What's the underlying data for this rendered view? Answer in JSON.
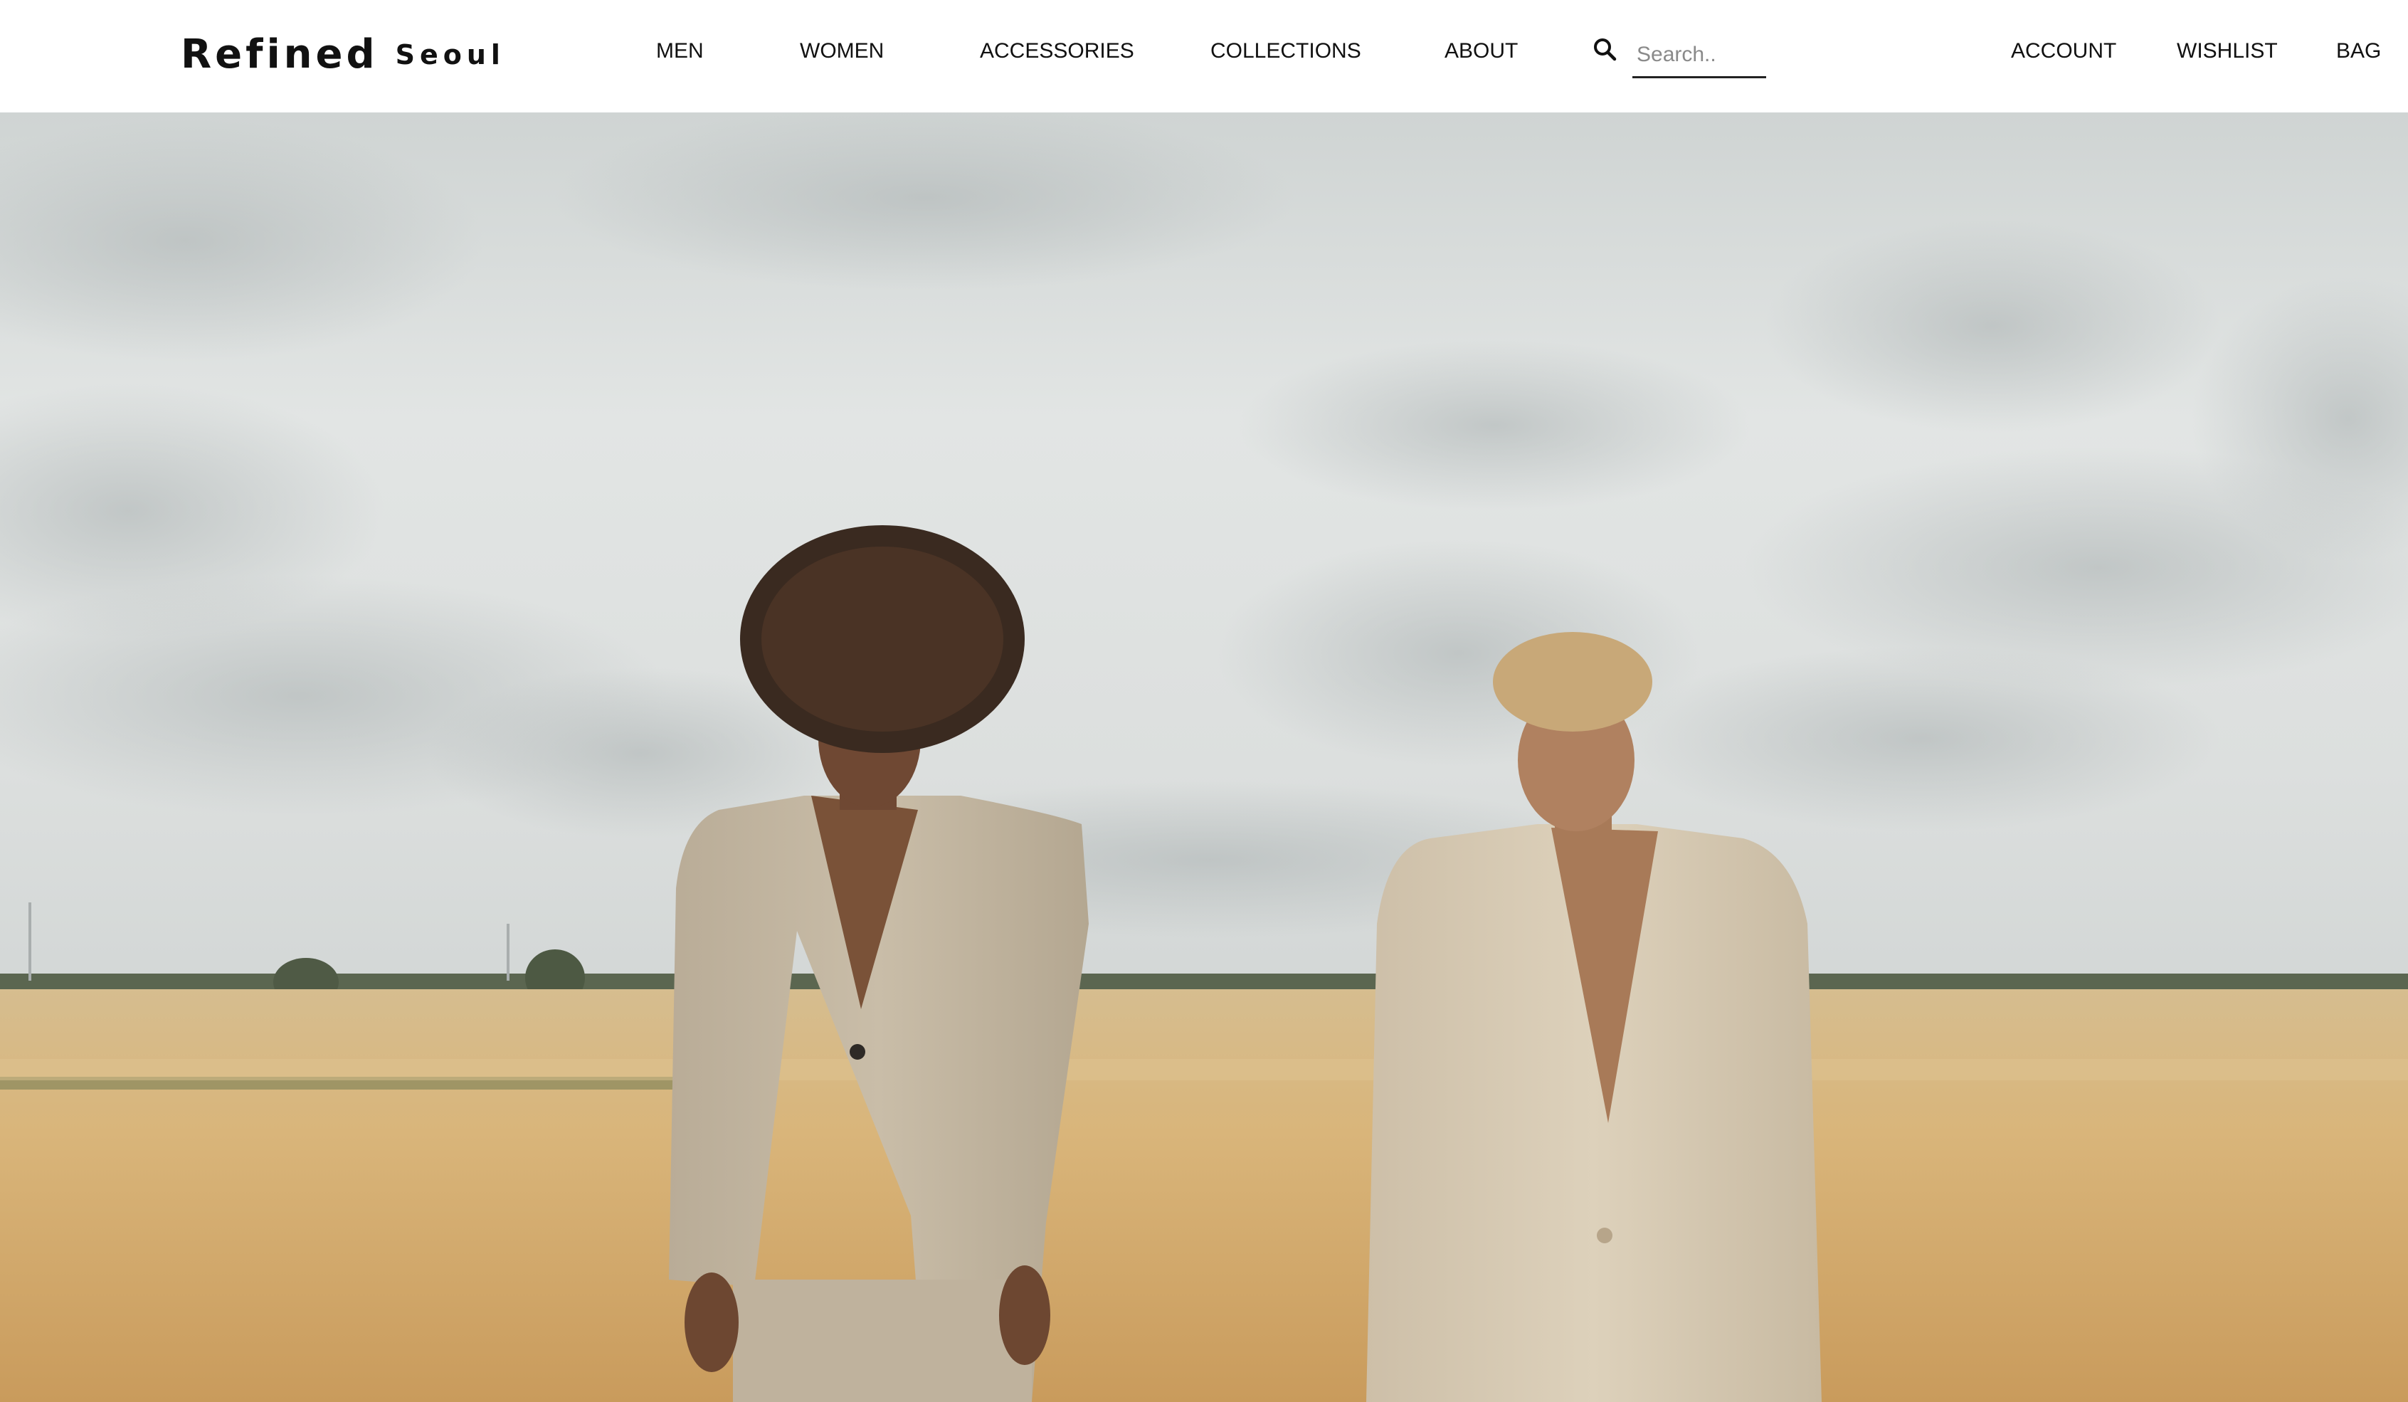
{
  "brand": {
    "name": "Refined",
    "city": "Seoul"
  },
  "nav": {
    "items": [
      {
        "label": "MEN"
      },
      {
        "label": "WOMEN"
      },
      {
        "label": "ACCESSORIES"
      },
      {
        "label": "COLLECTIONS"
      },
      {
        "label": "ABOUT"
      }
    ]
  },
  "search": {
    "placeholder": "Search..",
    "value": "",
    "icon": "search-icon"
  },
  "account_nav": {
    "items": [
      {
        "label": "ACCOUNT"
      },
      {
        "label": "WISHLIST"
      },
      {
        "label": "BAG"
      }
    ]
  },
  "colors": {
    "header_bg": "#ffffff",
    "text": "#111111",
    "sky": "#dfe3e2",
    "field": "#d7b57e",
    "suit": "#c8bba7"
  }
}
